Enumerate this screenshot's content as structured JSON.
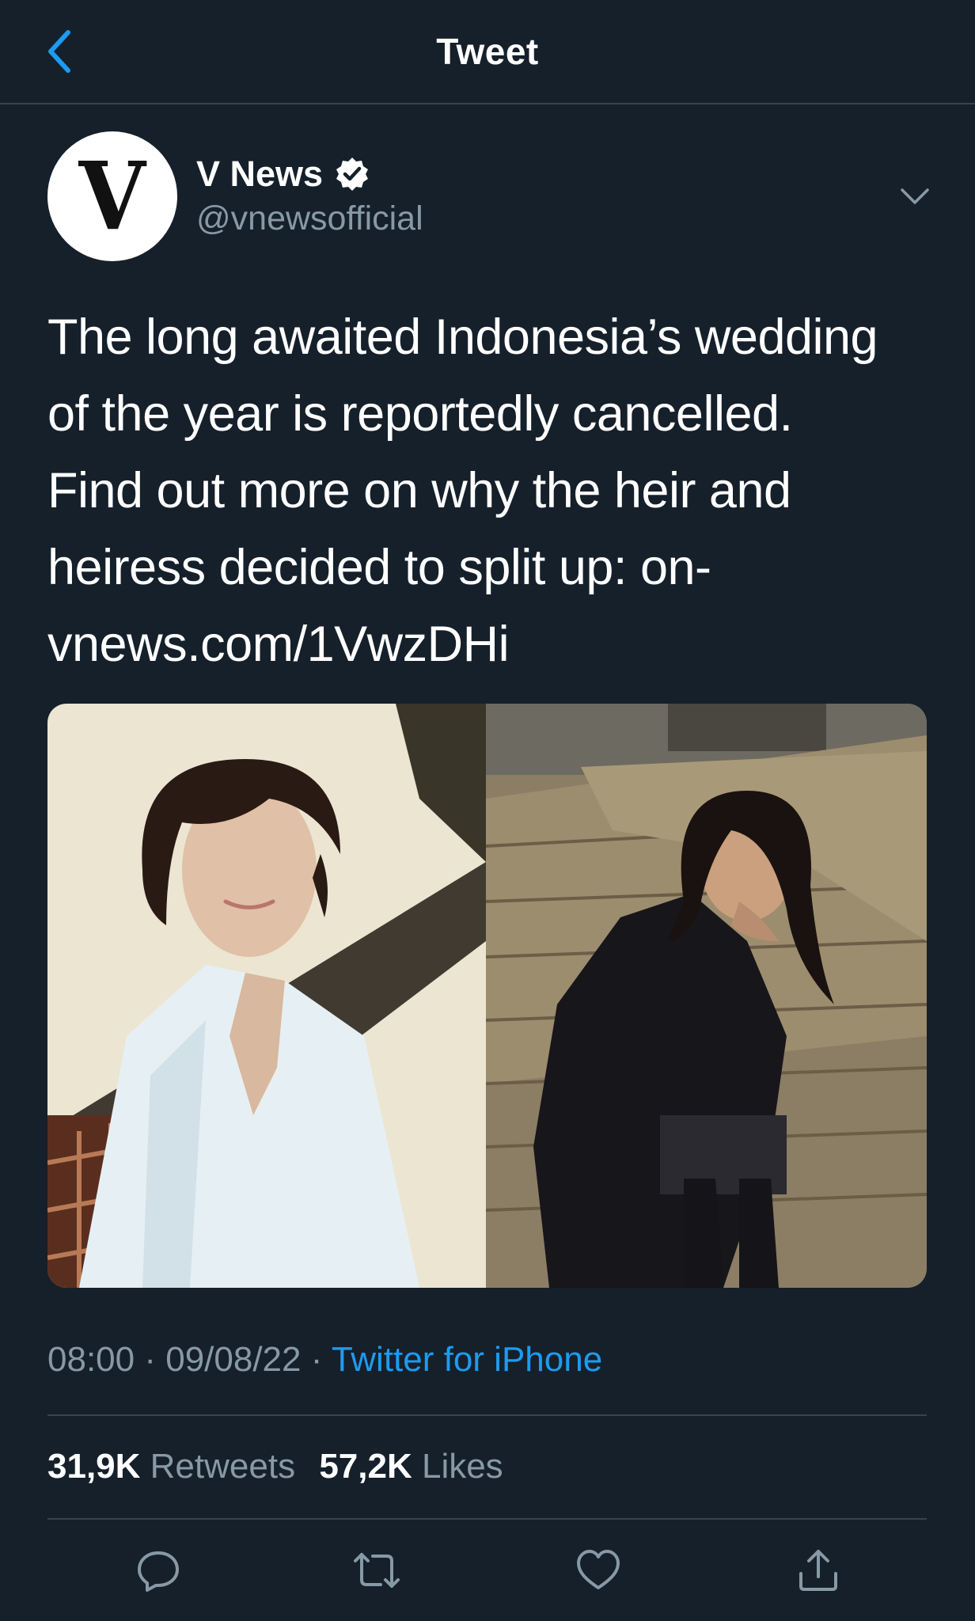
{
  "header": {
    "title": "Tweet",
    "back_icon": "chevron-left-icon"
  },
  "author": {
    "avatar_letter": "V",
    "name": "V News",
    "handle": "@vnewsofficial",
    "verified": true
  },
  "tweet": {
    "lines": [
      "The long awaited Indonesia’s wedding",
      "of the year is reportedly cancelled.",
      "Find out more on why the heir and",
      "heiress decided to split up: on-",
      "vnews.com/1VwzDHi"
    ]
  },
  "media": {
    "count": 2
  },
  "meta": {
    "time": "08:00",
    "sep1": " · ",
    "date": "09/08/22",
    "sep2": " · ",
    "source": "Twitter for iPhone"
  },
  "stats": {
    "retweets": "31,9K",
    "retweets_label": "Retweets",
    "likes": "57,2K",
    "likes_label": "Likes"
  },
  "actions": [
    "reply-icon",
    "retweet-icon",
    "like-icon",
    "share-icon"
  ],
  "colors": {
    "background": "#15202b",
    "divider": "#38444d",
    "muted": "#8899a6",
    "accent": "#1d9bf0"
  }
}
